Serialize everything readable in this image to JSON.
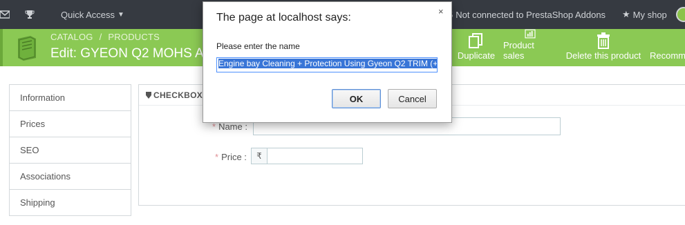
{
  "topbar": {
    "quick_access": "Quick Access",
    "addons_status": "Not connected to PrestaShop Addons",
    "my_shop": "My shop",
    "icons": [
      "envelope-icon",
      "trophy-icon",
      "user-icon",
      "shop-icon"
    ]
  },
  "toolbar": {
    "breadcrumb": [
      "CATALOG",
      "PRODUCTS"
    ],
    "title": "Edit: GYEON Q2 MOHS A",
    "buttons": {
      "duplicate": "Duplicate",
      "sales": "Product sales",
      "delete": "Delete this product",
      "recommend": "Recomm"
    },
    "accent": "#8bc954"
  },
  "sidebar": {
    "items": [
      {
        "label": "Information"
      },
      {
        "label": "Prices"
      },
      {
        "label": "SEO"
      },
      {
        "label": "Associations"
      },
      {
        "label": "Shipping"
      }
    ]
  },
  "panel": {
    "header": "CHECKBOX C",
    "name_label": "Name :",
    "price_label": "Price :",
    "currency": "₹",
    "name_value": "",
    "price_value": ""
  },
  "dialog": {
    "title": "The page at localhost says:",
    "close": "×",
    "message": "Please enter the name",
    "input_value": "Engine bay Cleaning + Protection Using Gyeon Q2 TRIM (+",
    "ok": "OK",
    "cancel": "Cancel"
  }
}
